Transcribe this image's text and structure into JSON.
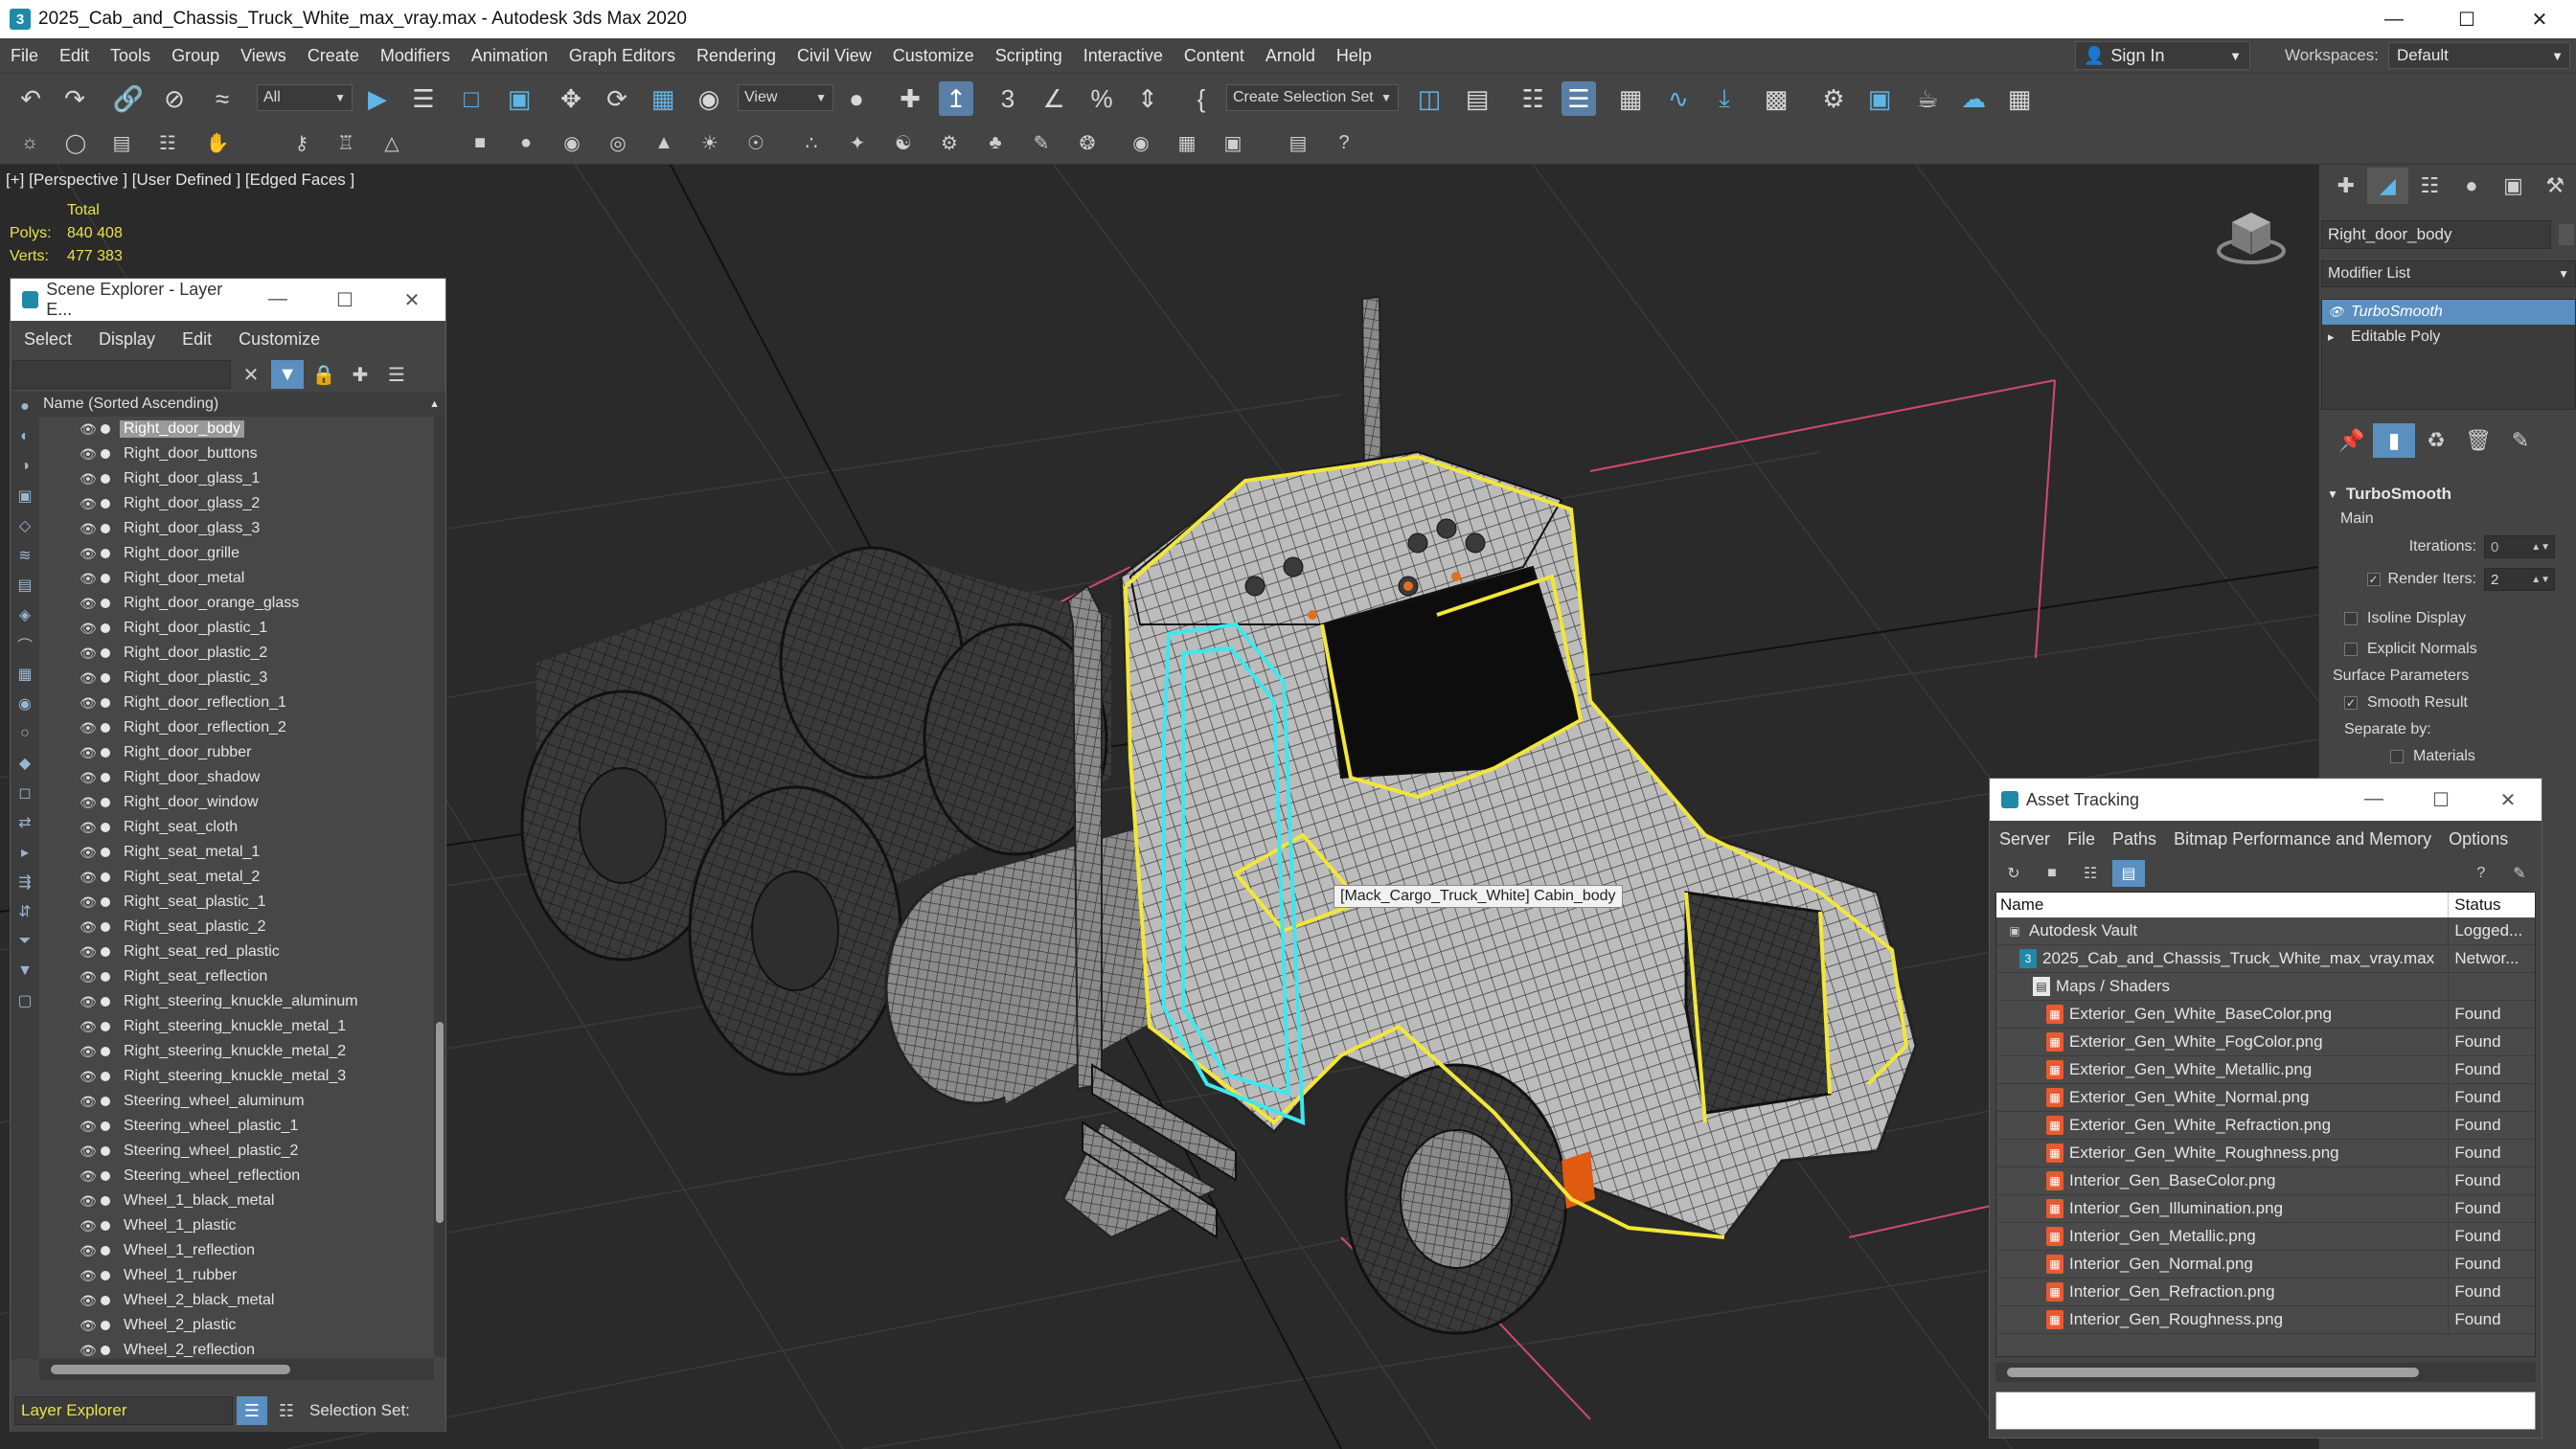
{
  "window": {
    "title": "2025_Cab_and_Chassis_Truck_White_max_vray.max - Autodesk 3ds Max 2020",
    "icon": "3ds-max-icon",
    "controls": {
      "minimize": "—",
      "maximize": "☐",
      "close": "✕"
    }
  },
  "menubar": {
    "items": [
      "File",
      "Edit",
      "Tools",
      "Group",
      "Views",
      "Create",
      "Modifiers",
      "Animation",
      "Graph Editors",
      "Rendering",
      "Civil View",
      "Customize",
      "Scripting",
      "Interactive",
      "Content",
      "Arnold",
      "Help"
    ],
    "sign_in": "Sign In",
    "workspaces_label": "Workspaces:",
    "workspaces_value": "Default"
  },
  "toolbar": {
    "selection_filter": "All",
    "reference_coord": "View",
    "selection_set_placeholder": "Create Selection Set"
  },
  "viewport": {
    "label": "[+] [Perspective ] [User Defined ] [Edged Faces ]",
    "stats": {
      "total_label": "Total",
      "polys_label": "Polys:",
      "polys_value": "840 408",
      "verts_label": "Verts:",
      "verts_value": "477 383"
    },
    "tooltip": "[Mack_Cargo_Truck_White] Cabin_body"
  },
  "scene_explorer": {
    "title": "Scene Explorer - Layer E...",
    "menu": [
      "Select",
      "Display",
      "Edit",
      "Customize"
    ],
    "column_header": "Name (Sorted Ascending)",
    "items": [
      "Right_door_body",
      "Right_door_buttons",
      "Right_door_glass_1",
      "Right_door_glass_2",
      "Right_door_glass_3",
      "Right_door_grille",
      "Right_door_metal",
      "Right_door_orange_glass",
      "Right_door_plastic_1",
      "Right_door_plastic_2",
      "Right_door_plastic_3",
      "Right_door_reflection_1",
      "Right_door_reflection_2",
      "Right_door_rubber",
      "Right_door_shadow",
      "Right_door_window",
      "Right_seat_cloth",
      "Right_seat_metal_1",
      "Right_seat_metal_2",
      "Right_seat_plastic_1",
      "Right_seat_plastic_2",
      "Right_seat_red_plastic",
      "Right_seat_reflection",
      "Right_steering_knuckle_aluminum",
      "Right_steering_knuckle_metal_1",
      "Right_steering_knuckle_metal_2",
      "Right_steering_knuckle_metal_3",
      "Steering_wheel_aluminum",
      "Steering_wheel_plastic_1",
      "Steering_wheel_plastic_2",
      "Steering_wheel_reflection",
      "Wheel_1_black_metal",
      "Wheel_1_plastic",
      "Wheel_1_reflection",
      "Wheel_1_rubber",
      "Wheel_2_black_metal",
      "Wheel_2_plastic",
      "Wheel_2_reflection"
    ],
    "selected_index": 0,
    "footer_layer": "Layer Explorer",
    "footer_selection_set": "Selection Set:"
  },
  "command_panel": {
    "object_name": "Right_door_body",
    "modifier_list": "Modifier List",
    "stack": [
      "TurboSmooth",
      "Editable Poly"
    ],
    "rollout_title": "TurboSmooth",
    "main_label": "Main",
    "iterations_label": "Iterations:",
    "iterations_value": "0",
    "render_iters_label": "Render Iters:",
    "render_iters_value": "2",
    "isoline_label": "Isoline Display",
    "explicit_normals_label": "Explicit Normals",
    "surface_params_label": "Surface Parameters",
    "smooth_result_label": "Smooth Result",
    "separate_by_label": "Separate by:",
    "materials_label": "Materials"
  },
  "asset_tracking": {
    "title": "Asset Tracking",
    "menu": [
      "Server",
      "File",
      "Paths",
      "Bitmap Performance and Memory",
      "Options"
    ],
    "col_name": "Name",
    "col_status": "Status",
    "rows": [
      {
        "name": "Autodesk Vault",
        "status": "Logged...",
        "indent": 0,
        "icon": "vault"
      },
      {
        "name": "2025_Cab_and_Chassis_Truck_White_max_vray.max",
        "status": "Networ...",
        "indent": 1,
        "icon": "max"
      },
      {
        "name": "Maps / Shaders",
        "status": "",
        "indent": 2,
        "icon": "folder"
      },
      {
        "name": "Exterior_Gen_White_BaseColor.png",
        "status": "Found",
        "indent": 3,
        "icon": "png"
      },
      {
        "name": "Exterior_Gen_White_FogColor.png",
        "status": "Found",
        "indent": 3,
        "icon": "png"
      },
      {
        "name": "Exterior_Gen_White_Metallic.png",
        "status": "Found",
        "indent": 3,
        "icon": "png"
      },
      {
        "name": "Exterior_Gen_White_Normal.png",
        "status": "Found",
        "indent": 3,
        "icon": "png"
      },
      {
        "name": "Exterior_Gen_White_Refraction.png",
        "status": "Found",
        "indent": 3,
        "icon": "png"
      },
      {
        "name": "Exterior_Gen_White_Roughness.png",
        "status": "Found",
        "indent": 3,
        "icon": "png"
      },
      {
        "name": "Interior_Gen_BaseColor.png",
        "status": "Found",
        "indent": 3,
        "icon": "png"
      },
      {
        "name": "Interior_Gen_Illumination.png",
        "status": "Found",
        "indent": 3,
        "icon": "png"
      },
      {
        "name": "Interior_Gen_Metallic.png",
        "status": "Found",
        "indent": 3,
        "icon": "png"
      },
      {
        "name": "Interior_Gen_Normal.png",
        "status": "Found",
        "indent": 3,
        "icon": "png"
      },
      {
        "name": "Interior_Gen_Refraction.png",
        "status": "Found",
        "indent": 3,
        "icon": "png"
      },
      {
        "name": "Interior_Gen_Roughness.png",
        "status": "Found",
        "indent": 3,
        "icon": "png"
      }
    ]
  },
  "colors": {
    "selection_yellow": "#f2e63a",
    "highlight_cyan": "#3de8ef",
    "active_blue": "#5a8fc0",
    "stats_yellow": "#e7e24a"
  }
}
